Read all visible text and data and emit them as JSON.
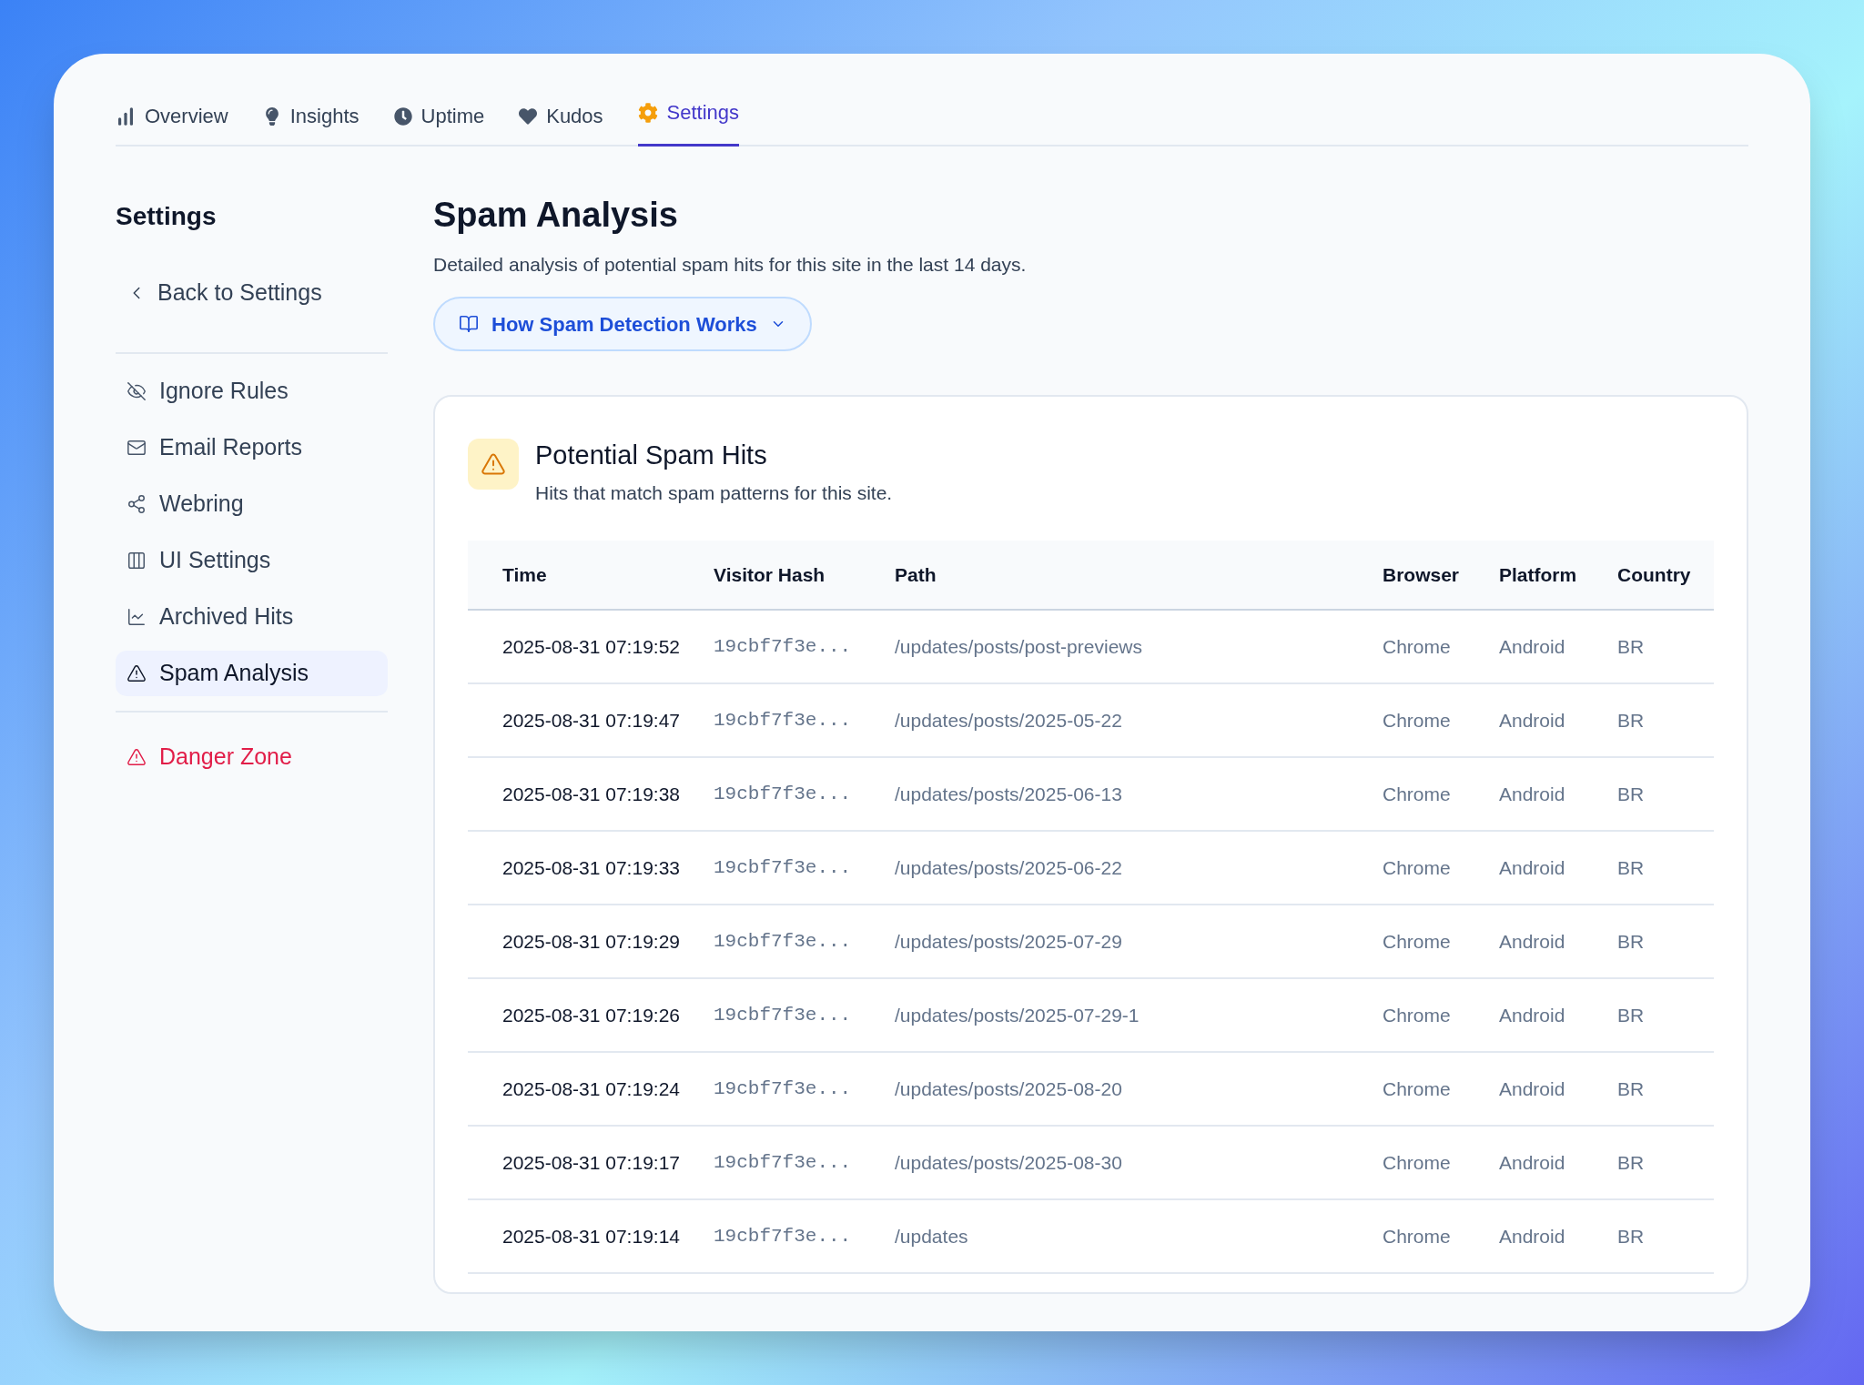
{
  "tabs": [
    {
      "label": "Overview",
      "selected": false
    },
    {
      "label": "Insights",
      "selected": false
    },
    {
      "label": "Uptime",
      "selected": false
    },
    {
      "label": "Kudos",
      "selected": false
    },
    {
      "label": "Settings",
      "selected": true
    }
  ],
  "sidebar": {
    "title": "Settings",
    "back": "Back to Settings",
    "items": [
      {
        "label": "Ignore Rules",
        "selected": false
      },
      {
        "label": "Email Reports",
        "selected": false
      },
      {
        "label": "Webring",
        "selected": false
      },
      {
        "label": "UI Settings",
        "selected": false
      },
      {
        "label": "Archived Hits",
        "selected": false
      },
      {
        "label": "Spam Analysis",
        "selected": true
      }
    ],
    "danger": {
      "label": "Danger Zone"
    }
  },
  "page": {
    "title": "Spam Analysis",
    "description": "Detailed analysis of potential spam hits for this site in the last 14 days.",
    "help_button": "How Spam Detection Works"
  },
  "card": {
    "title": "Potential Spam Hits",
    "subtitle": "Hits that match spam patterns for this site."
  },
  "table": {
    "columns": [
      "Time",
      "Visitor Hash",
      "Path",
      "Browser",
      "Platform",
      "Country"
    ],
    "rows": [
      [
        "2025-08-31 07:19:52",
        "19cbf7f3e...",
        "/updates/posts/post-previews",
        "Chrome",
        "Android",
        "BR"
      ],
      [
        "2025-08-31 07:19:47",
        "19cbf7f3e...",
        "/updates/posts/2025-05-22",
        "Chrome",
        "Android",
        "BR"
      ],
      [
        "2025-08-31 07:19:38",
        "19cbf7f3e...",
        "/updates/posts/2025-06-13",
        "Chrome",
        "Android",
        "BR"
      ],
      [
        "2025-08-31 07:19:33",
        "19cbf7f3e...",
        "/updates/posts/2025-06-22",
        "Chrome",
        "Android",
        "BR"
      ],
      [
        "2025-08-31 07:19:29",
        "19cbf7f3e...",
        "/updates/posts/2025-07-29",
        "Chrome",
        "Android",
        "BR"
      ],
      [
        "2025-08-31 07:19:26",
        "19cbf7f3e...",
        "/updates/posts/2025-07-29-1",
        "Chrome",
        "Android",
        "BR"
      ],
      [
        "2025-08-31 07:19:24",
        "19cbf7f3e...",
        "/updates/posts/2025-08-20",
        "Chrome",
        "Android",
        "BR"
      ],
      [
        "2025-08-31 07:19:17",
        "19cbf7f3e...",
        "/updates/posts/2025-08-30",
        "Chrome",
        "Android",
        "BR"
      ],
      [
        "2025-08-31 07:19:14",
        "19cbf7f3e...",
        "/updates",
        "Chrome",
        "Android",
        "BR"
      ]
    ]
  }
}
